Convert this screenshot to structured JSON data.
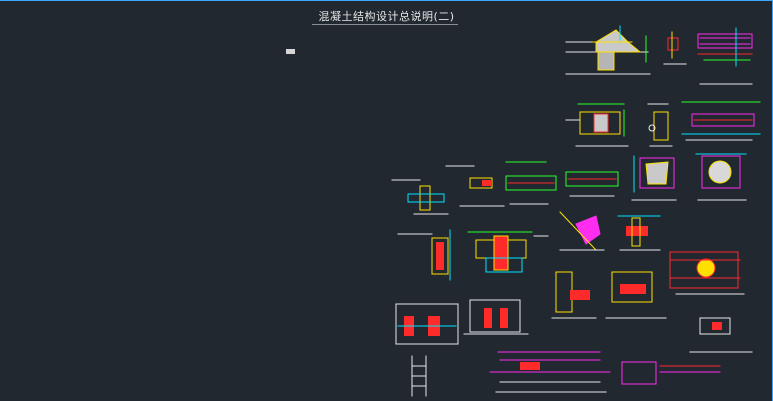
{
  "drawing": {
    "title": "混凝土结构设计总说明(二)"
  },
  "colors": {
    "background": "#212830",
    "border": "#3fa9ff",
    "red": "#ff2a2a",
    "magenta": "#ff2df0",
    "yellow": "#ffe000",
    "cyan": "#00e5ff",
    "green": "#2cff2c",
    "white": "#e8e8e8",
    "gray": "#9aa0a6"
  },
  "icons": [
    "small-block-icon"
  ]
}
